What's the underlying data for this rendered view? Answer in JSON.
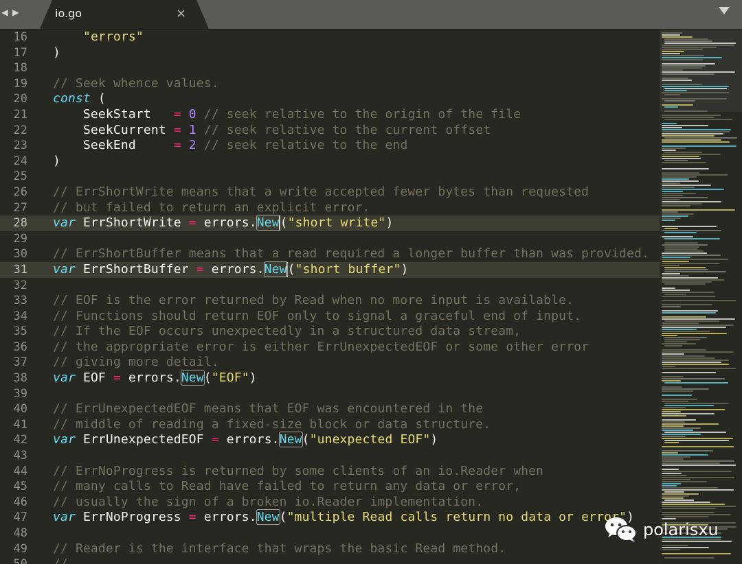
{
  "tab": {
    "title": "io.go",
    "close_glyph": "×"
  },
  "icons": {
    "nav_back": "left-arrow-icon",
    "nav_forward": "right-arrow-icon",
    "dropdown": "chevron-down-icon",
    "watermark": "wechat-icon"
  },
  "colors": {
    "background": "#272822",
    "string": "#e6db74",
    "comment": "#75715e",
    "keyword": "#66d9ef",
    "operator": "#f92672",
    "number": "#ae81ff",
    "text": "#f8f8f2"
  },
  "watermark": {
    "text": "polarisxu"
  },
  "editor": {
    "active_lines": [
      28,
      31
    ],
    "lines": [
      {
        "n": 16,
        "tokens": [
          [
            "pl",
            "    "
          ],
          [
            "str",
            "\"errors\""
          ]
        ]
      },
      {
        "n": 17,
        "tokens": [
          [
            "pl",
            ")"
          ]
        ]
      },
      {
        "n": 18,
        "tokens": []
      },
      {
        "n": 19,
        "tokens": [
          [
            "com",
            "// Seek whence values."
          ]
        ]
      },
      {
        "n": 20,
        "tokens": [
          [
            "kw",
            "const"
          ],
          [
            "pl",
            " ("
          ]
        ]
      },
      {
        "n": 21,
        "tokens": [
          [
            "pl",
            "    SeekStart   "
          ],
          [
            "op",
            "="
          ],
          [
            "pl",
            " "
          ],
          [
            "num",
            "0"
          ],
          [
            "pl",
            " "
          ],
          [
            "com",
            "// seek relative to the origin of the file"
          ]
        ]
      },
      {
        "n": 22,
        "tokens": [
          [
            "pl",
            "    SeekCurrent "
          ],
          [
            "op",
            "="
          ],
          [
            "pl",
            " "
          ],
          [
            "num",
            "1"
          ],
          [
            "pl",
            " "
          ],
          [
            "com",
            "// seek relative to the current offset"
          ]
        ]
      },
      {
        "n": 23,
        "tokens": [
          [
            "pl",
            "    SeekEnd     "
          ],
          [
            "op",
            "="
          ],
          [
            "pl",
            " "
          ],
          [
            "num",
            "2"
          ],
          [
            "pl",
            " "
          ],
          [
            "com",
            "// seek relative to the end"
          ]
        ]
      },
      {
        "n": 24,
        "tokens": [
          [
            "pl",
            ")"
          ]
        ]
      },
      {
        "n": 25,
        "tokens": []
      },
      {
        "n": 26,
        "tokens": [
          [
            "com",
            "// ErrShortWrite means that a write accepted fewer bytes than requested"
          ]
        ]
      },
      {
        "n": 27,
        "tokens": [
          [
            "com",
            "// but failed to return an explicit error."
          ]
        ]
      },
      {
        "n": 28,
        "tokens": [
          [
            "kw",
            "var"
          ],
          [
            "pl",
            " ErrShortWrite "
          ],
          [
            "op",
            "="
          ],
          [
            "pl",
            " errors."
          ],
          [
            "fn",
            "New"
          ],
          [
            "cursor",
            ""
          ],
          [
            "pl",
            "("
          ],
          [
            "str",
            "\"short write\""
          ],
          [
            "pl",
            ")"
          ]
        ]
      },
      {
        "n": 29,
        "tokens": []
      },
      {
        "n": 30,
        "tokens": [
          [
            "com",
            "// ErrShortBuffer means that a read required a longer buffer than was provided."
          ]
        ]
      },
      {
        "n": 31,
        "tokens": [
          [
            "kw",
            "var"
          ],
          [
            "pl",
            " ErrShortBuffer "
          ],
          [
            "op",
            "="
          ],
          [
            "pl",
            " errors."
          ],
          [
            "fn",
            "New"
          ],
          [
            "cursor",
            ""
          ],
          [
            "pl",
            "("
          ],
          [
            "str",
            "\"short buffer\""
          ],
          [
            "pl",
            ")"
          ]
        ]
      },
      {
        "n": 32,
        "tokens": []
      },
      {
        "n": 33,
        "tokens": [
          [
            "com",
            "// EOF is the error returned by Read when no more input is available."
          ]
        ]
      },
      {
        "n": 34,
        "tokens": [
          [
            "com",
            "// Functions should return EOF only to signal a graceful end of input."
          ]
        ]
      },
      {
        "n": 35,
        "tokens": [
          [
            "com",
            "// If the EOF occurs unexpectedly in a structured data stream,"
          ]
        ]
      },
      {
        "n": 36,
        "tokens": [
          [
            "com",
            "// the appropriate error is either ErrUnexpectedEOF or some other error"
          ]
        ]
      },
      {
        "n": 37,
        "tokens": [
          [
            "com",
            "// giving more detail."
          ]
        ]
      },
      {
        "n": 38,
        "tokens": [
          [
            "kw",
            "var"
          ],
          [
            "pl",
            " EOF "
          ],
          [
            "op",
            "="
          ],
          [
            "pl",
            " errors."
          ],
          [
            "fn",
            "New"
          ],
          [
            "pl",
            "("
          ],
          [
            "str",
            "\"EOF\""
          ],
          [
            "pl",
            ")"
          ]
        ]
      },
      {
        "n": 39,
        "tokens": []
      },
      {
        "n": 40,
        "tokens": [
          [
            "com",
            "// ErrUnexpectedEOF means that EOF was encountered in the"
          ]
        ]
      },
      {
        "n": 41,
        "tokens": [
          [
            "com",
            "// middle of reading a fixed-size block or data structure."
          ]
        ]
      },
      {
        "n": 42,
        "tokens": [
          [
            "kw",
            "var"
          ],
          [
            "pl",
            " ErrUnexpectedEOF "
          ],
          [
            "op",
            "="
          ],
          [
            "pl",
            " errors."
          ],
          [
            "fn",
            "New"
          ],
          [
            "pl",
            "("
          ],
          [
            "str",
            "\"unexpected EOF\""
          ],
          [
            "pl",
            ")"
          ]
        ]
      },
      {
        "n": 43,
        "tokens": []
      },
      {
        "n": 44,
        "tokens": [
          [
            "com",
            "// ErrNoProgress is returned by some clients of an io.Reader when"
          ]
        ]
      },
      {
        "n": 45,
        "tokens": [
          [
            "com",
            "// many calls to Read have failed to return any data or error,"
          ]
        ]
      },
      {
        "n": 46,
        "tokens": [
          [
            "com",
            "// usually the sign of a broken io.Reader implementation."
          ]
        ]
      },
      {
        "n": 47,
        "tokens": [
          [
            "kw",
            "var"
          ],
          [
            "pl",
            " ErrNoProgress "
          ],
          [
            "op",
            "="
          ],
          [
            "pl",
            " errors."
          ],
          [
            "fn",
            "New"
          ],
          [
            "pl",
            "("
          ],
          [
            "str",
            "\"multiple Read calls return no data or error\""
          ],
          [
            "pl",
            ")"
          ]
        ]
      },
      {
        "n": 48,
        "tokens": []
      },
      {
        "n": 49,
        "tokens": [
          [
            "com",
            "// Reader is the interface that wraps the basic Read method."
          ]
        ]
      },
      {
        "n": 50,
        "tokens": [
          [
            "com",
            "//"
          ]
        ]
      }
    ]
  }
}
